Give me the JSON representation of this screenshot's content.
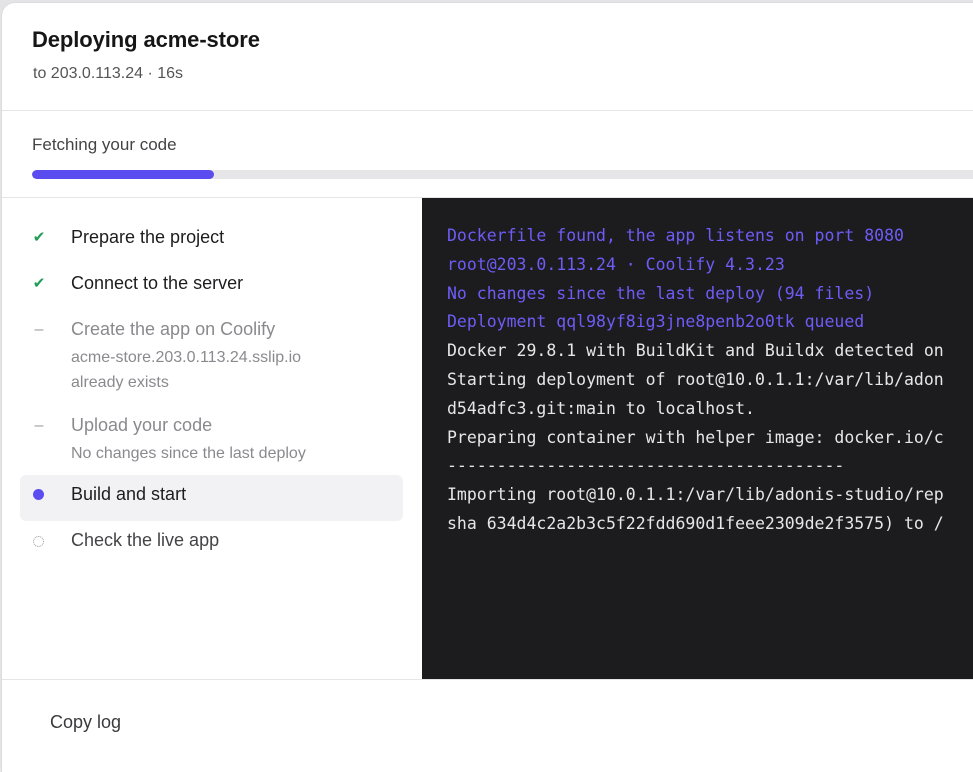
{
  "dialog": {
    "title": "Deploying acme-store",
    "subtitle": "to 203.0.113.24 · 16s"
  },
  "progress": {
    "label": "Fetching your code",
    "percent": 19
  },
  "steps": [
    {
      "label": "Prepare the project",
      "status": "done",
      "icon": "check-icon",
      "glyph": "✔"
    },
    {
      "label": "Connect to the server",
      "status": "done",
      "icon": "check-icon",
      "glyph": "✔"
    },
    {
      "label": "Create the app on Coolify",
      "status": "skipped",
      "icon": "dash-icon",
      "glyph": "–",
      "details": [
        "acme-store.203.0.113.24.sslip.io",
        "already exists"
      ]
    },
    {
      "label": "Upload your code",
      "status": "skipped",
      "icon": "dash-icon",
      "glyph": "–",
      "details": [
        "No changes since the last deploy"
      ]
    },
    {
      "label": "Build and start",
      "status": "active",
      "icon": "active-dot-icon",
      "glyph": ""
    },
    {
      "label": "Check the live app",
      "status": "pending",
      "icon": "pending-circle-icon",
      "glyph": ""
    }
  ],
  "log": [
    {
      "text": "Dockerfile found, the app listens on port 8080",
      "accent": true
    },
    {
      "text": "root@203.0.113.24 · Coolify 4.3.23",
      "accent": true
    },
    {
      "text": "No changes since the last deploy (94 files)",
      "accent": true
    },
    {
      "text": "Deployment qql98yf8ig3jne8penb2o0tk queued",
      "accent": true
    },
    {
      "text": "Docker 29.8.1 with BuildKit and Buildx detected on",
      "accent": false
    },
    {
      "text": "Starting deployment of root@10.0.1.1:/var/lib/adon",
      "accent": false
    },
    {
      "text": "d54adfc3.git:main to localhost.",
      "accent": false
    },
    {
      "text": "Preparing container with helper image: docker.io/c",
      "accent": false
    },
    {
      "text": "----------------------------------------",
      "accent": false
    },
    {
      "text": "Importing root@10.0.1.1:/var/lib/adonis-studio/rep",
      "accent": false
    },
    {
      "text": "sha 634d4c2a2b3c5f22fdd690d1feee2309de2f3575) to /",
      "accent": false
    }
  ],
  "footer": {
    "copy_label": "Copy log"
  },
  "colors": {
    "accent": "#5b4cf0",
    "done": "#1f9d55",
    "terminal_bg": "#1c1c1e"
  }
}
